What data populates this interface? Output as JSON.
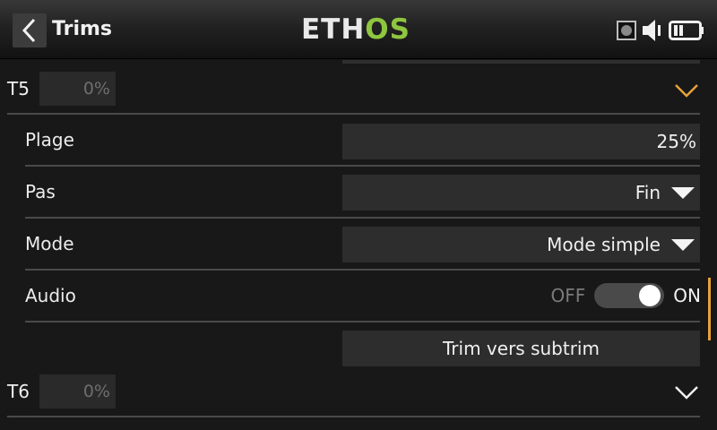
{
  "header": {
    "title": "Trims",
    "logo_left": "ETH",
    "logo_right": "OS",
    "colors": {
      "logo_accent": "#8ec63f",
      "accent": "#e8a23a"
    },
    "icons": [
      "back-icon",
      "sd-card-icon",
      "speaker-icon",
      "battery-icon"
    ]
  },
  "trims": [
    {
      "label": "T5",
      "value": "0%",
      "expanded": true,
      "settings": {
        "range": {
          "label": "Plage",
          "value": "25%"
        },
        "step": {
          "label": "Pas",
          "value": "Fin"
        },
        "mode": {
          "label": "Mode",
          "value": "Mode simple"
        },
        "audio": {
          "label": "Audio",
          "off_label": "OFF",
          "on_label": "ON",
          "state": "on"
        },
        "action": {
          "label": "Trim vers subtrim"
        }
      }
    },
    {
      "label": "T6",
      "value": "0%",
      "expanded": false
    }
  ]
}
